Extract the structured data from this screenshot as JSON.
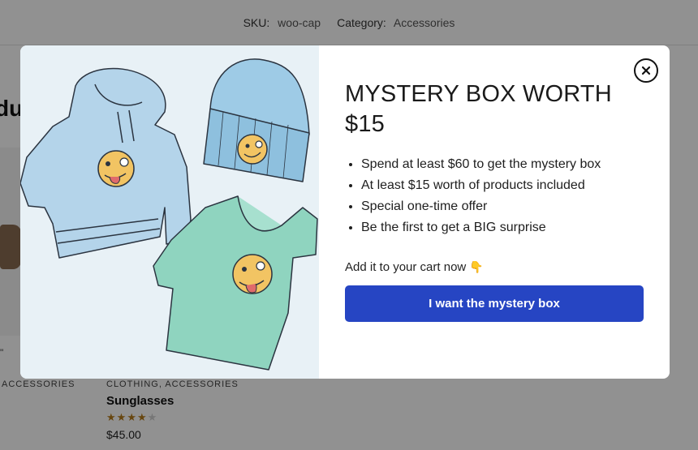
{
  "background": {
    "sku_label": "SKU:",
    "sku_value": "woo-cap",
    "category_label": "Category:",
    "category_value": "Accessories",
    "heading_fragment": "du",
    "left_card_categories": "ACCESSORIES",
    "product_categories": "CLOTHING, ACCESSORIES",
    "product_title": "Sunglasses",
    "product_rating": 4,
    "product_rating_max": 5,
    "product_price": "$45.00",
    "tick_fragment": "\""
  },
  "modal": {
    "title": "MYSTERY BOX WORTH $15",
    "bullets": [
      "Spend at least $60 to get the mystery box",
      "At least $15 worth of products included",
      "Special one-time offer",
      "Be the first to get a BIG surprise"
    ],
    "cta_text": "Add it to your cart now",
    "cta_emoji": "👇",
    "button_label": "I want the mystery box",
    "close_icon": "close-icon",
    "image_icon": "hoodie-beanie-tshirt-illustration",
    "colors": {
      "button": "#2645c3",
      "image_bg": "#e8f1f6",
      "hoodie": "#b4d4ea",
      "beanie": "#9ecbe6",
      "tshirt": "#8fd4bf",
      "emoji_face": "#f2c463"
    }
  }
}
